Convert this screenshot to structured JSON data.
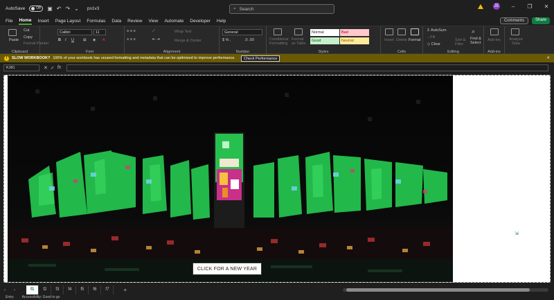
{
  "titlebar": {
    "autosave_label": "AutoSave",
    "autosave_state": "Off",
    "filename": "ps1v3",
    "search_placeholder": "Search",
    "avatar_initial": "JE"
  },
  "tabs": [
    "File",
    "Home",
    "Insert",
    "Page Layout",
    "Formulas",
    "Data",
    "Review",
    "View",
    "Automate",
    "Developer",
    "Help"
  ],
  "active_tab": "Home",
  "comments_label": "Comments",
  "share_label": "Share",
  "ribbon": {
    "clipboard": {
      "paste": "Paste",
      "cut": "Cut",
      "copy": "Copy",
      "format_painter": "Format Painter",
      "label": "Clipboard"
    },
    "font": {
      "name": "Calibri",
      "size": "11",
      "label": "Font"
    },
    "alignment": {
      "wrap": "Wrap Text",
      "merge": "Merge & Center",
      "label": "Alignment"
    },
    "number": {
      "format": "General",
      "label": "Number"
    },
    "styles": {
      "cond": "Conditional Formatting",
      "table": "Format as Table",
      "normal": "Normal",
      "bad": "Bad",
      "good": "Good",
      "neutral": "Neutral",
      "label": "Styles"
    },
    "cells": {
      "insert": "Insert",
      "delete": "Delete",
      "format": "Format",
      "label": "Cells"
    },
    "editing": {
      "autosum": "AutoSum",
      "fill": "Fill",
      "clear": "Clear",
      "sort": "Sort & Filter",
      "find": "Find & Select",
      "label": "Editing"
    },
    "addins": {
      "addins": "Add-ins",
      "analyze": "Analyze Data",
      "label": "Add-ins"
    }
  },
  "warning": {
    "title": "SLOW WORKBOOK?",
    "message": "100% of your workbook has unused formatting and metadata that can be optimized to improve performance.",
    "button": "Check Performance"
  },
  "formula": {
    "namebox": "KJ81"
  },
  "cta_label": "CLICK FOR A NEW YEAR",
  "sheets": [
    "f1",
    "f2",
    "f3",
    "f4",
    "f5",
    "f6",
    "f7"
  ],
  "active_sheet": "f1",
  "status": {
    "mode": "Entry",
    "accessibility": "Accessibility: Good to go"
  },
  "colors": {
    "accent": "#107c41",
    "warn_bg": "#6b5a05",
    "neon": "#2ecc55"
  }
}
